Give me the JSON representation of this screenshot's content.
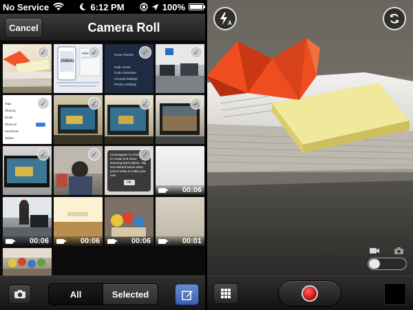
{
  "status_bar": {
    "carrier": "No Service",
    "time": "6:12 PM",
    "battery": "100%",
    "battery_level": 1.0,
    "icons": [
      "wifi-icon",
      "moon-icon",
      "rotation-lock-icon",
      "location-arrow-icon",
      "battery-icon"
    ]
  },
  "nav": {
    "cancel_label": "Cancel",
    "title": "Camera Roll"
  },
  "thumbnails": [
    {
      "kind": "photo",
      "selected": true,
      "duration": ""
    },
    {
      "kind": "photo",
      "selected": true,
      "duration": "",
      "text": "258841"
    },
    {
      "kind": "photo",
      "selected": true,
      "duration": "",
      "menu": [
        "Close Friends",
        "Help Center",
        "Code Generator",
        "Account Settings",
        "Privacy Settings"
      ]
    },
    {
      "kind": "photo",
      "selected": true,
      "duration": ""
    },
    {
      "kind": "photo",
      "selected": true,
      "duration": "",
      "labels": [
        "Tags",
        "Sharing",
        "Email",
        "Show on",
        "Facebook",
        "Twitter"
      ]
    },
    {
      "kind": "photo",
      "selected": true,
      "duration": ""
    },
    {
      "kind": "photo",
      "selected": true,
      "duration": ""
    },
    {
      "kind": "photo",
      "selected": true,
      "duration": ""
    },
    {
      "kind": "photo",
      "selected": true,
      "duration": ""
    },
    {
      "kind": "photo",
      "selected": true,
      "duration": ""
    },
    {
      "kind": "photo",
      "selected": true,
      "duration": "",
      "text": "Cinemagram is a fun way to create and share stunning short videos. Tap Get Started below when you're ready to make your own.",
      "ok": "OK"
    },
    {
      "kind": "video",
      "selected": false,
      "duration": "00:06"
    },
    {
      "kind": "video",
      "selected": false,
      "duration": "00:06"
    },
    {
      "kind": "video",
      "selected": false,
      "duration": "00:06"
    },
    {
      "kind": "video",
      "selected": false,
      "duration": "00:06"
    },
    {
      "kind": "video",
      "selected": false,
      "duration": "00:01"
    },
    {
      "kind": "photo",
      "selected": false,
      "duration": ""
    }
  ],
  "toolbar": {
    "segment_all": "All",
    "segment_selected": "Selected",
    "active_segment": "All"
  },
  "camera": {
    "flash_icon": "flash-auto-icon",
    "flash_letter": "A",
    "switch_icon": "switch-camera-icon",
    "mode_toggle": "photo/video",
    "colors": {
      "record": "#d01818",
      "edit_button": "#4a6fbd"
    }
  }
}
